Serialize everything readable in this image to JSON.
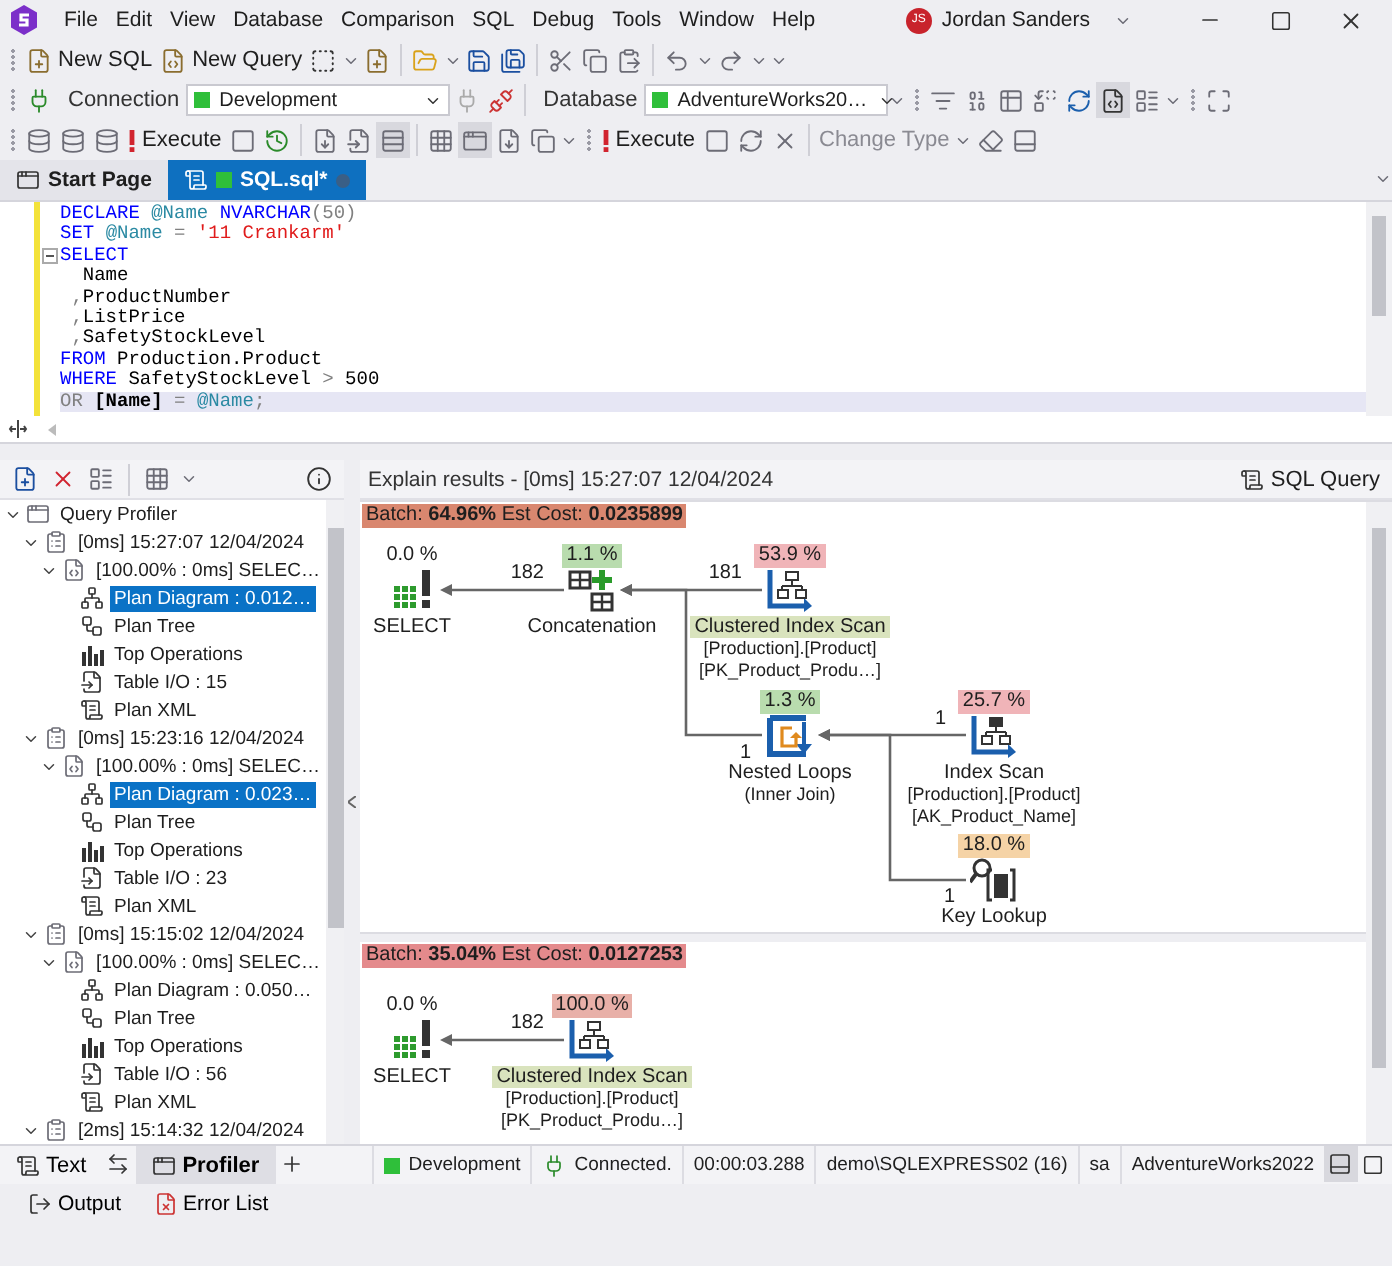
{
  "app": {
    "menu": [
      "File",
      "Edit",
      "View",
      "Database",
      "Comparison",
      "SQL",
      "Debug",
      "Tools",
      "Window",
      "Help"
    ],
    "user_initials": "JS",
    "user_name": "Jordan Sanders"
  },
  "toolbar": {
    "new_sql": "New SQL",
    "new_query": "New Query",
    "connection_label": "Connection",
    "connection": "Development",
    "database_label": "Database",
    "database": "AdventureWorks20…",
    "execute": "Execute",
    "execute_alt": "Execute",
    "change_type": "Change Type"
  },
  "doc_tabs": [
    {
      "label": "Start Page",
      "kind": "start",
      "selected": false
    },
    {
      "label": "SQL.sql*",
      "kind": "sql",
      "selected": true
    }
  ],
  "editor": {
    "lines": [
      {
        "current": false,
        "fold": false,
        "tokens": [
          {
            "kind": "keyword",
            "text": "DECLARE "
          },
          {
            "kind": "variable",
            "text": "@Name "
          },
          {
            "kind": "keyword",
            "text": "NVARCHAR"
          },
          {
            "kind": "operator",
            "text": "(50)"
          }
        ]
      },
      {
        "current": false,
        "fold": false,
        "tokens": [
          {
            "kind": "keyword",
            "text": "SET "
          },
          {
            "kind": "variable",
            "text": "@Name "
          },
          {
            "kind": "operator",
            "text": "= "
          },
          {
            "kind": "string",
            "text": "'11 Crankarm'"
          }
        ]
      },
      {
        "current": false,
        "fold": true,
        "tokens": [
          {
            "kind": "keyword",
            "text": "SELECT"
          }
        ]
      },
      {
        "current": false,
        "fold": false,
        "tokens": [
          {
            "kind": "plain",
            "text": "  Name"
          }
        ]
      },
      {
        "current": false,
        "fold": false,
        "tokens": [
          {
            "kind": "operator",
            "text": " ,"
          },
          {
            "kind": "plain",
            "text": "ProductNumber"
          }
        ]
      },
      {
        "current": false,
        "fold": false,
        "tokens": [
          {
            "kind": "operator",
            "text": " ,"
          },
          {
            "kind": "plain",
            "text": "ListPrice"
          }
        ]
      },
      {
        "current": false,
        "fold": false,
        "tokens": [
          {
            "kind": "operator",
            "text": " ,"
          },
          {
            "kind": "plain",
            "text": "SafetyStockLevel"
          }
        ]
      },
      {
        "current": false,
        "fold": false,
        "tokens": [
          {
            "kind": "keyword",
            "text": "FROM "
          },
          {
            "kind": "plain",
            "text": "Production.Product"
          }
        ]
      },
      {
        "current": false,
        "fold": false,
        "tokens": [
          {
            "kind": "keyword",
            "text": "WHERE "
          },
          {
            "kind": "plain",
            "text": "SafetyStockLevel "
          },
          {
            "kind": "operator",
            "text": "> "
          },
          {
            "kind": "plain",
            "text": "500"
          }
        ]
      },
      {
        "current": true,
        "fold": false,
        "tokens": [
          {
            "kind": "operator",
            "text": "OR "
          },
          {
            "kind": "plain",
            "text": "[Name] "
          },
          {
            "kind": "operator",
            "text": "= "
          },
          {
            "kind": "variable",
            "text": "@Name"
          },
          {
            "kind": "operator",
            "text": ";"
          }
        ]
      }
    ]
  },
  "profiler": {
    "tree": [
      {
        "label": "Query Profiler",
        "kind": "profiler",
        "expanded": true,
        "selected": false,
        "children": [
          {
            "label": "[0ms] 15:27:07 12/04/2024",
            "kind": "session",
            "expanded": true,
            "selected": false,
            "children": [
              {
                "label": "[100.00% : 0ms] SELEC…",
                "kind": "statement",
                "expanded": true,
                "selected": false,
                "children": [
                  {
                    "label": "Plan Diagram : 0.012…",
                    "kind": "plan-diagram",
                    "selected": true
                  },
                  {
                    "label": "Plan Tree",
                    "kind": "plan-tree",
                    "selected": false
                  },
                  {
                    "label": "Top Operations",
                    "kind": "top-ops",
                    "selected": false
                  },
                  {
                    "label": "Table I/O : 15",
                    "kind": "table-io",
                    "selected": false
                  },
                  {
                    "label": "Plan XML",
                    "kind": "plan-xml",
                    "selected": false
                  }
                ]
              }
            ]
          },
          {
            "label": "[0ms] 15:23:16 12/04/2024",
            "kind": "session",
            "expanded": true,
            "selected": false,
            "children": [
              {
                "label": "[100.00% : 0ms] SELEC…",
                "kind": "statement",
                "expanded": true,
                "selected": false,
                "children": [
                  {
                    "label": "Plan Diagram : 0.023…",
                    "kind": "plan-diagram",
                    "selected": true
                  },
                  {
                    "label": "Plan Tree",
                    "kind": "plan-tree",
                    "selected": false
                  },
                  {
                    "label": "Top Operations",
                    "kind": "top-ops",
                    "selected": false
                  },
                  {
                    "label": "Table I/O : 23",
                    "kind": "table-io",
                    "selected": false
                  },
                  {
                    "label": "Plan XML",
                    "kind": "plan-xml",
                    "selected": false
                  }
                ]
              }
            ]
          },
          {
            "label": "[0ms] 15:15:02 12/04/2024",
            "kind": "session",
            "expanded": true,
            "selected": false,
            "children": [
              {
                "label": "[100.00% : 0ms] SELEC…",
                "kind": "statement",
                "expanded": true,
                "selected": false,
                "children": [
                  {
                    "label": "Plan Diagram : 0.050…",
                    "kind": "plan-diagram",
                    "selected": false
                  },
                  {
                    "label": "Plan Tree",
                    "kind": "plan-tree",
                    "selected": false
                  },
                  {
                    "label": "Top Operations",
                    "kind": "top-ops",
                    "selected": false
                  },
                  {
                    "label": "Table I/O : 56",
                    "kind": "table-io",
                    "selected": false
                  },
                  {
                    "label": "Plan XML",
                    "kind": "plan-xml",
                    "selected": false
                  }
                ]
              }
            ]
          },
          {
            "label": "[2ms] 15:14:32 12/04/2024",
            "kind": "session",
            "expanded": true,
            "selected": false
          }
        ]
      }
    ]
  },
  "explain": {
    "title": "Explain results - [0ms] 15:27:07 12/04/2024",
    "sql_query": "SQL Query",
    "batches": [
      {
        "header": "Batch: **64.96%** Est Cost: **0.0235899**",
        "color": "#d9876f",
        "root": {
          "kind": "select",
          "cost": "0.0 %",
          "name": "SELECT",
          "highlighted": false,
          "children": [
            {
              "kind": "concatenation",
              "cost": "1.1 %",
              "color": "#b9dcae",
              "rows": "182",
              "name": "Concatenation",
              "highlighted": false,
              "children": [
                {
                  "kind": "clustered-scan",
                  "cost": "53.9 %",
                  "color": "#f0b4b8",
                  "rows": "181",
                  "name": "Clustered Index Scan",
                  "details": [
                    "[Production].[Product]",
                    "[PK_Product_Produ…]"
                  ],
                  "highlighted": true
                },
                {
                  "kind": "nested-loops",
                  "cost": "1.3 %",
                  "color": "#b9dcae",
                  "rows": "1",
                  "name": "Nested Loops",
                  "details": [
                    "(Inner Join)"
                  ],
                  "highlighted": false,
                  "children": [
                    {
                      "kind": "index-scan",
                      "cost": "25.7 %",
                      "color": "#f0b4b8",
                      "rows": "1",
                      "name": "Index Scan",
                      "details": [
                        "[Production].[Product]",
                        "[AK_Product_Name]"
                      ],
                      "highlighted": false
                    },
                    {
                      "kind": "key-lookup",
                      "cost": "18.0 %",
                      "color": "#f5d3a6",
                      "rows": "1",
                      "name": "Key Lookup",
                      "highlighted": false
                    }
                  ]
                }
              ]
            }
          ]
        }
      },
      {
        "header": "Batch: **35.04%** Est Cost: **0.0127253**",
        "color": "#e48a8c",
        "root": {
          "kind": "select",
          "cost": "0.0 %",
          "name": "SELECT",
          "highlighted": false,
          "children": [
            {
              "kind": "clustered-scan",
              "cost": "100.0 %",
              "color": "#e8b0a8",
              "rows": "182",
              "name": "Clustered Index Scan",
              "details": [
                "[Production].[Product]",
                "[PK_Product_Produ…]"
              ],
              "highlighted": true
            }
          ]
        }
      }
    ]
  },
  "result_tabs": [
    {
      "label": "Text",
      "kind": "text",
      "selected": false
    },
    {
      "label": "Profiler",
      "kind": "profiler",
      "selected": true
    }
  ],
  "status": [
    {
      "kind": "connection",
      "text": "Development"
    },
    {
      "kind": "connected",
      "text": "Connected."
    },
    {
      "kind": "plain",
      "text": "00:00:03.288"
    },
    {
      "kind": "plain",
      "text": "demo\\SQLEXPRESS02 (16)"
    },
    {
      "kind": "plain",
      "text": "sa"
    },
    {
      "kind": "plain",
      "text": "AdventureWorks2022"
    }
  ],
  "output_tabs": [
    {
      "label": "Output",
      "kind": "output"
    },
    {
      "label": "Error List",
      "kind": "errors"
    }
  ]
}
